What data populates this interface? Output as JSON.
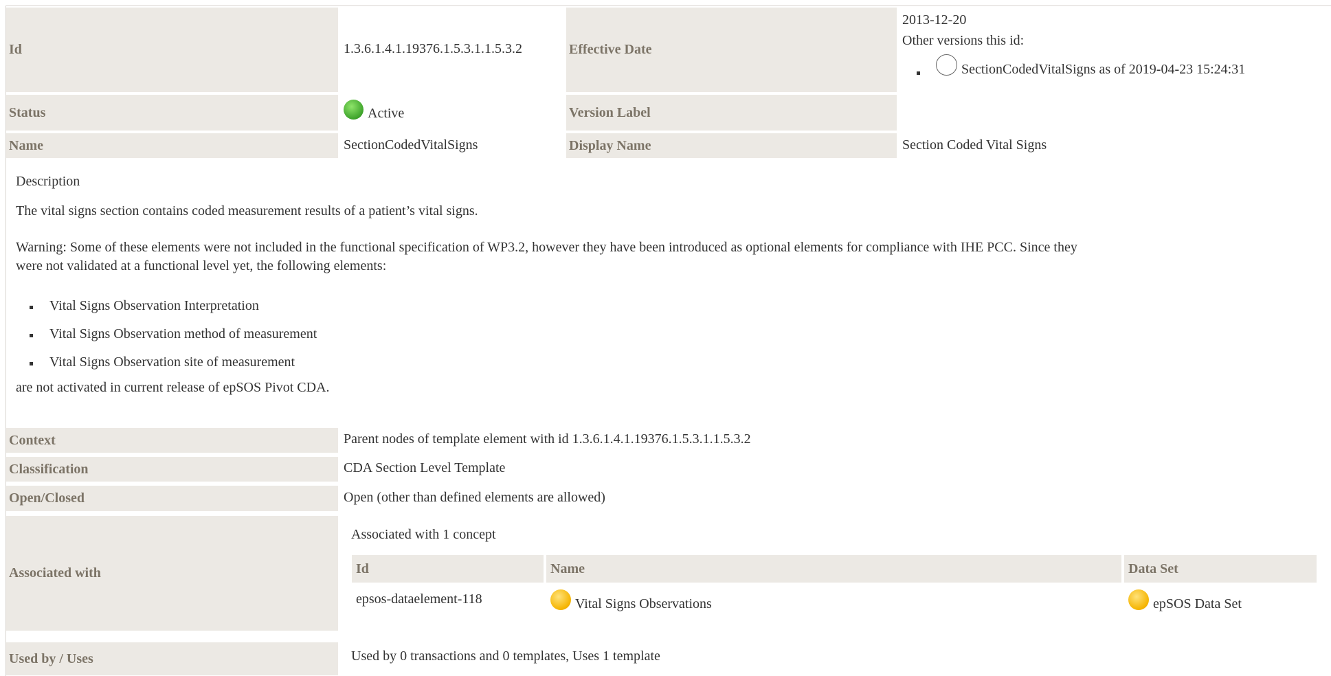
{
  "header": {
    "id_label": "Id",
    "id_value": "1.3.6.1.4.1.19376.1.5.3.1.1.5.3.2",
    "effective_date_label": "Effective Date",
    "effective_date_value": "2013-12-20",
    "other_versions_label": "Other versions this id:",
    "other_versions": [
      "SectionCodedVitalSigns as of 2019-04-23 15:24:31"
    ],
    "status_label": "Status",
    "status_value": "Active",
    "version_label_label": "Version Label",
    "version_label_value": "",
    "name_label": "Name",
    "name_value": "SectionCodedVitalSigns",
    "display_name_label": "Display Name",
    "display_name_value": "Section Coded Vital Signs"
  },
  "description": {
    "heading": "Description",
    "para1": "The vital signs section contains coded measurement results of a patient’s vital signs.",
    "warning_line1": "Warning: Some of these elements were not included in the functional specification of WP3.2, however they have been introduced as optional elements for compliance with IHE PCC. Since they",
    "warning_line2": "were not validated at a functional level yet, the following elements:",
    "items": [
      "Vital Signs Observation Interpretation",
      "Vital Signs Observation method of measurement",
      "Vital Signs Observation site of measurement"
    ],
    "closing": "are not activated in current release of epSOS Pivot CDA."
  },
  "details": {
    "context_label": "Context",
    "context_value": "Parent nodes of template element with id 1.3.6.1.4.1.19376.1.5.3.1.1.5.3.2",
    "classification_label": "Classification",
    "classification_value": "CDA Section Level Template",
    "open_closed_label": "Open/Closed",
    "open_closed_value": "Open (other than defined elements are allowed)",
    "associated_label": "Associated with",
    "associated_intro": "Associated with 1 concept",
    "assoc_columns": [
      "Id",
      "Name",
      "Data Set"
    ],
    "assoc_rows": [
      {
        "id": "epsos-dataelement-118",
        "name": "Vital Signs Observations",
        "dataset": "epSOS Data Set"
      }
    ],
    "used_by_label": "Used by / Uses",
    "used_by_value": "Used by 0 transactions and 0 templates, Uses 1 template"
  },
  "colors": {
    "label_bg": "#ece9e4",
    "label_text": "#7c7467",
    "status_active": "#3ea32b",
    "status_draft": "#f5b400"
  }
}
